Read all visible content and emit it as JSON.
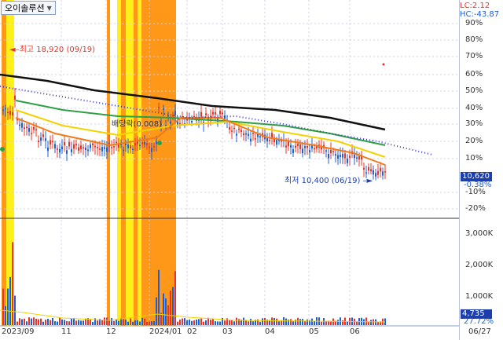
{
  "stock_name": "오이솔루션",
  "lc_text": "LC:2.12",
  "hc_text": "HC:-43.87",
  "annotations": {
    "high": "최고 18,920 (09/19)",
    "low": "최저 10,400 (06/19)",
    "dividend": "배당락(0.008)"
  },
  "price_axis": [
    "90%",
    "80%",
    "70%",
    "60%",
    "50%",
    "40%",
    "30%",
    "20%",
    "10%",
    "-10%",
    "-20%"
  ],
  "current_price": "10,620",
  "current_change": "-0.38%",
  "volume_axis": [
    "3,000K",
    "2,000K",
    "1,000K"
  ],
  "current_volume": "4,735",
  "volume_change": "27.72%",
  "x_axis": [
    "2023/09",
    "11",
    "12",
    "2024/01",
    "02",
    "03",
    "04",
    "05",
    "06",
    "06/27"
  ],
  "colors": {
    "candle_up": "#e8332a",
    "candle_down": "#1d5fd6",
    "ma_black": "#111111",
    "ma_green": "#2ea043",
    "ma_yellow": "#f2d200",
    "ma_orange": "#f07b1d",
    "ma_red": "#e0301e",
    "ma_dots": "#3a3ac8",
    "highlight_orange": "#ff8c00",
    "highlight_yellow": "#ffee00"
  }
}
